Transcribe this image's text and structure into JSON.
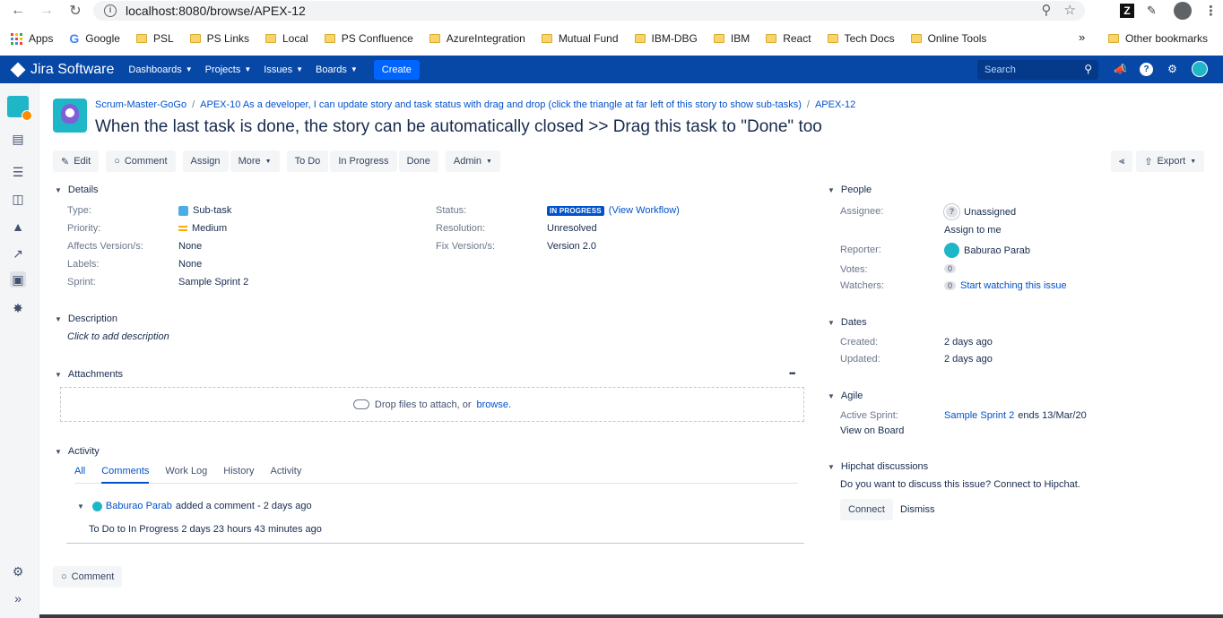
{
  "browser": {
    "url": "localhost:8080/browse/APEX-12",
    "bookmarks": [
      "Apps",
      "Google",
      "PSL",
      "PS Links",
      "Local",
      "PS Confluence",
      "AzureIntegration",
      "Mutual Fund",
      "IBM-DBG",
      "IBM",
      "React",
      "Tech Docs",
      "Online Tools"
    ],
    "more": "»",
    "other_bookmarks": "Other bookmarks"
  },
  "header": {
    "logo": "Jira Software",
    "nav": [
      "Dashboards",
      "Projects",
      "Issues",
      "Boards"
    ],
    "create": "Create",
    "search_placeholder": "Search"
  },
  "issue": {
    "project": "Scrum-Master-GoGo",
    "parent": "APEX-10 As a developer, I can update story and task status with drag and drop (click the triangle at far left of this story to show sub-tasks)",
    "key": "APEX-12",
    "title": "When the last task is done, the story can be automatically closed >> Drag this task to \"Done\" too"
  },
  "toolbar": {
    "edit": "Edit",
    "comment": "Comment",
    "assign": "Assign",
    "more": "More",
    "todo": "To Do",
    "in_progress": "In Progress",
    "done": "Done",
    "admin": "Admin",
    "export": "Export"
  },
  "details": {
    "heading": "Details",
    "type_label": "Type:",
    "type": "Sub-task",
    "priority_label": "Priority:",
    "priority": "Medium",
    "affects_label": "Affects Version/s:",
    "affects": "None",
    "labels_label": "Labels:",
    "labels": "None",
    "sprint_label": "Sprint:",
    "sprint": "Sample Sprint 2",
    "status_label": "Status:",
    "status": "IN PROGRESS",
    "view_workflow": "(View Workflow)",
    "resolution_label": "Resolution:",
    "resolution": "Unresolved",
    "fix_label": "Fix Version/s:",
    "fix": "Version 2.0"
  },
  "description": {
    "heading": "Description",
    "placeholder": "Click to add description"
  },
  "attachments": {
    "heading": "Attachments",
    "more": "•••",
    "drop_text": "Drop files to attach, or",
    "browse": "browse."
  },
  "activity": {
    "heading": "Activity",
    "tabs": [
      "All",
      "Comments",
      "Work Log",
      "History",
      "Activity"
    ],
    "author": "Baburao Parab",
    "action": "added a comment - 2 days ago",
    "body": "To Do to In Progress 2 days 23 hours 43 minutes ago",
    "comment_button": "Comment"
  },
  "people": {
    "heading": "People",
    "assignee_label": "Assignee:",
    "assignee": "Unassigned",
    "assign_to_me": "Assign to me",
    "reporter_label": "Reporter:",
    "reporter": "Baburao Parab",
    "votes_label": "Votes:",
    "votes": "0",
    "watchers_label": "Watchers:",
    "watchers": "0",
    "start_watching": "Start watching this issue"
  },
  "dates": {
    "heading": "Dates",
    "created_label": "Created:",
    "created": "2 days ago",
    "updated_label": "Updated:",
    "updated": "2 days ago"
  },
  "agile": {
    "heading": "Agile",
    "active_label": "Active Sprint:",
    "active_sprint": "Sample Sprint 2",
    "ends": "ends 13/Mar/20",
    "view_board": "View on Board"
  },
  "hipchat": {
    "heading": "Hipchat discussions",
    "text": "Do you want to discuss this issue? Connect to Hipchat.",
    "connect": "Connect",
    "dismiss": "Dismiss"
  }
}
